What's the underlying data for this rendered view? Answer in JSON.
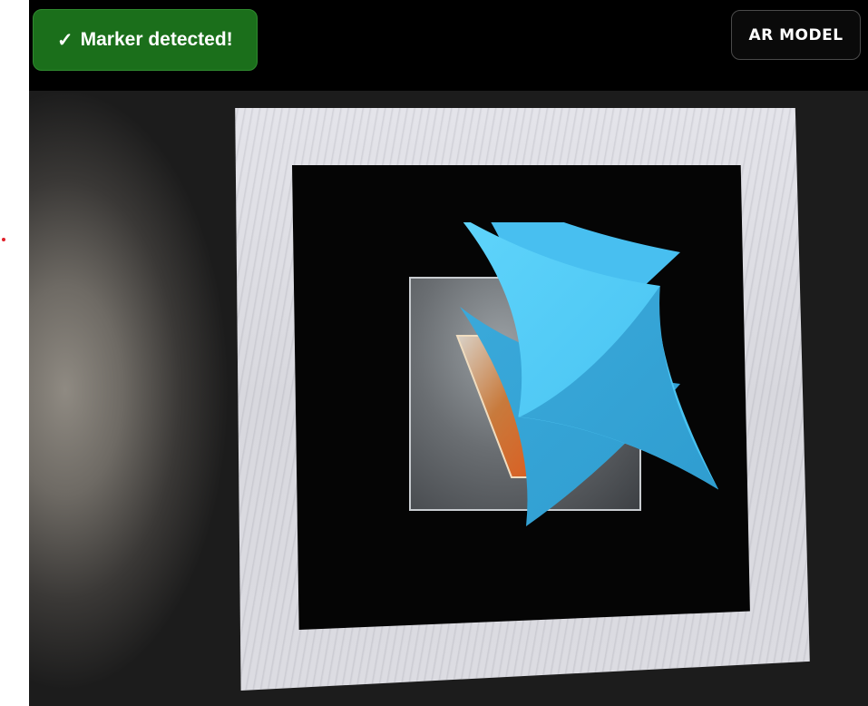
{
  "status": {
    "check_glyph": "✓",
    "text": "Marker detected!",
    "color": "#1b6f1b"
  },
  "toolbar": {
    "ar_model_label": "AR MODEL"
  },
  "scene": {
    "model_color": "#4ec6f2",
    "marker_icon": "letter-v-logo-icon",
    "model_icon": "astroid-3d-model"
  }
}
